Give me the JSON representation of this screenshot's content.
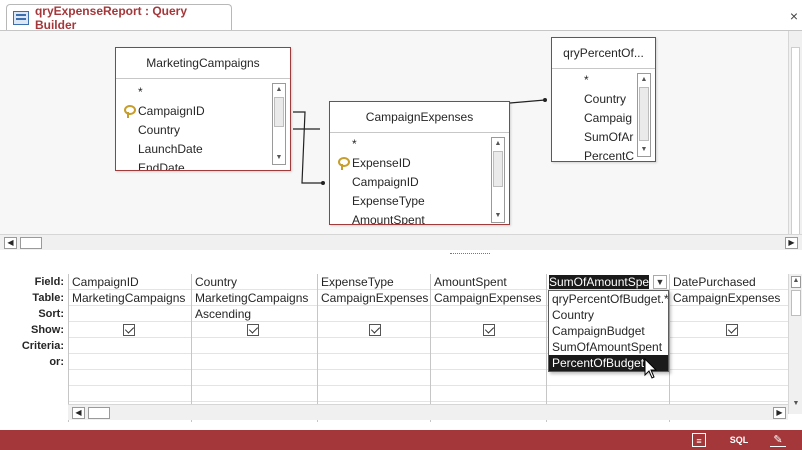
{
  "window": {
    "tab_title": "qryExpenseReport : Query Builder",
    "close_glyph": "×"
  },
  "tables": {
    "marketing_campaigns": {
      "title": "MarketingCampaigns",
      "fields": [
        "*",
        "CampaignID",
        "Country",
        "LaunchDate",
        "EndDate"
      ]
    },
    "campaign_expenses": {
      "title": "CampaignExpenses",
      "fields": [
        "*",
        "ExpenseID",
        "CampaignID",
        "ExpenseType",
        "AmountSpent"
      ]
    },
    "qry_percent": {
      "title": "qryPercentOf...",
      "fields": [
        "*",
        "Country",
        "Campaig",
        "SumOfAr",
        "PercentC"
      ]
    }
  },
  "grid": {
    "row_labels": [
      "Field:",
      "Table:",
      "Sort:",
      "Show:",
      "Criteria:",
      "or:"
    ],
    "columns": [
      {
        "field": "CampaignID",
        "table": "MarketingCampaigns",
        "sort": "",
        "show": true
      },
      {
        "field": "Country",
        "table": "MarketingCampaigns",
        "sort": "Ascending",
        "show": true
      },
      {
        "field": "ExpenseType",
        "table": "CampaignExpenses",
        "sort": "",
        "show": true
      },
      {
        "field": "AmountSpent",
        "table": "CampaignExpenses",
        "sort": "",
        "show": true
      },
      {
        "field": "SumOfAmountSpe",
        "table": "",
        "sort": "",
        "show": false
      },
      {
        "field": "DatePurchased",
        "table": "CampaignExpenses",
        "sort": "",
        "show": true
      }
    ]
  },
  "dropdown": {
    "options": [
      "qryPercentOfBudget.*",
      "Country",
      "CampaignBudget",
      "SumOfAmountSpent",
      "PercentOfBudget"
    ],
    "selected_index": 4
  },
  "status_bar": {
    "sql_label": "SQL",
    "color": "#a4373a"
  },
  "colors": {
    "table_border": "#a23b3b",
    "title": "#a4373a"
  }
}
